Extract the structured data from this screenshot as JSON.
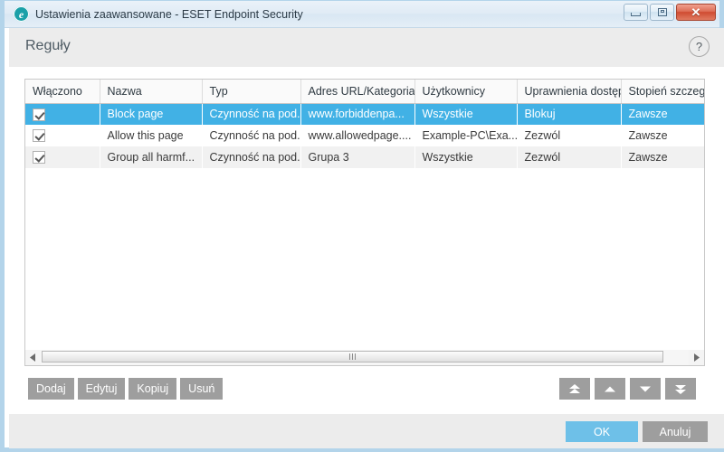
{
  "window": {
    "title": "Ustawienia zaawansowane - ESET Endpoint Security",
    "logo_icon": "eset-e-logo",
    "controls": {
      "minimize": "minimize-icon",
      "maximize": "maximize-icon",
      "close": "close-icon"
    }
  },
  "header": {
    "title": "Reguły",
    "help_label": "?"
  },
  "table": {
    "columns": [
      "Włączono",
      "Nazwa",
      "Typ",
      "Adres URL/Kategoria",
      "Użytkownicy",
      "Uprawnienia dostępu",
      "Stopień szczegół"
    ],
    "rows": [
      {
        "enabled": true,
        "name": "Block page",
        "type": "Czynność na pod...",
        "url": "www.forbiddenpa...",
        "users": "Wszystkie",
        "permission": "Blokuj",
        "detail": "Zawsze",
        "selected": true
      },
      {
        "enabled": true,
        "name": "Allow this page",
        "type": "Czynność na pod...",
        "url": "www.allowedpage....",
        "users": "Example-PC\\Exa...",
        "permission": "Zezwól",
        "detail": "Zawsze",
        "selected": false
      },
      {
        "enabled": true,
        "name": "Group all harmf...",
        "type": "Czynność na pod...",
        "url": "Grupa 3",
        "users": "Wszystkie",
        "permission": "Zezwól",
        "detail": "Zawsze",
        "selected": false
      }
    ]
  },
  "toolbar": {
    "add_label": "Dodaj",
    "edit_label": "Edytuj",
    "copy_label": "Kopiuj",
    "delete_label": "Usuń",
    "move_top_icon": "double-chevron-up-icon",
    "move_up_icon": "chevron-up-icon",
    "move_down_icon": "chevron-down-icon",
    "move_bottom_icon": "double-chevron-down-icon"
  },
  "footer": {
    "ok_label": "OK",
    "cancel_label": "Anuluj"
  },
  "colors": {
    "selection": "#41b1e5",
    "primary_button": "#6ec0e8",
    "neutral_button": "#9e9e9e",
    "brand_teal": "#1ba0a8"
  }
}
